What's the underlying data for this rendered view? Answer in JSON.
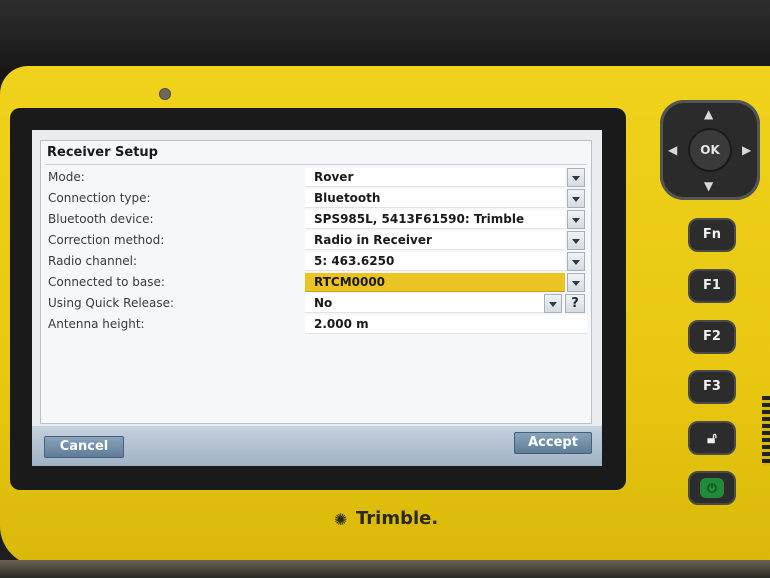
{
  "form": {
    "title": "Receiver Setup",
    "rows": [
      {
        "label": "Mode:",
        "value": "Rover",
        "control": "dropdown"
      },
      {
        "label": "Connection type:",
        "value": "Bluetooth",
        "control": "dropdown"
      },
      {
        "label": "Bluetooth device:",
        "value": "SPS985L, 5413F61590: Trimble",
        "control": "dropdown"
      },
      {
        "label": "Correction method:",
        "value": "Radio in Receiver",
        "control": "dropdown"
      },
      {
        "label": "Radio channel:",
        "value": "5: 463.6250",
        "control": "dropdown"
      },
      {
        "label": "Connected to base:",
        "value": "RTCM0000",
        "control": "dropdown-selected"
      },
      {
        "label": "Using Quick Release:",
        "value": "No",
        "control": "dropdown-help"
      },
      {
        "label": "Antenna height:",
        "value": "2.000 m",
        "control": "text"
      }
    ],
    "help_label": "?"
  },
  "buttons": {
    "cancel_label": "Cancel",
    "accept_label": "Accept"
  },
  "hardware": {
    "ok_label": "OK",
    "fn_label": "Fn",
    "f1_label": "F1",
    "f2_label": "F2",
    "f3_label": "F3",
    "brand_label": "Trimble."
  },
  "colors": {
    "selected_field": "#e9c423",
    "device_body": "#e8c810",
    "button_blue": "#6f8ba8"
  },
  "icons": {
    "dropdown": "chevron-down-icon",
    "lock": "unlock-icon",
    "power": "power-icon",
    "brand": "trimble-logo-icon"
  }
}
